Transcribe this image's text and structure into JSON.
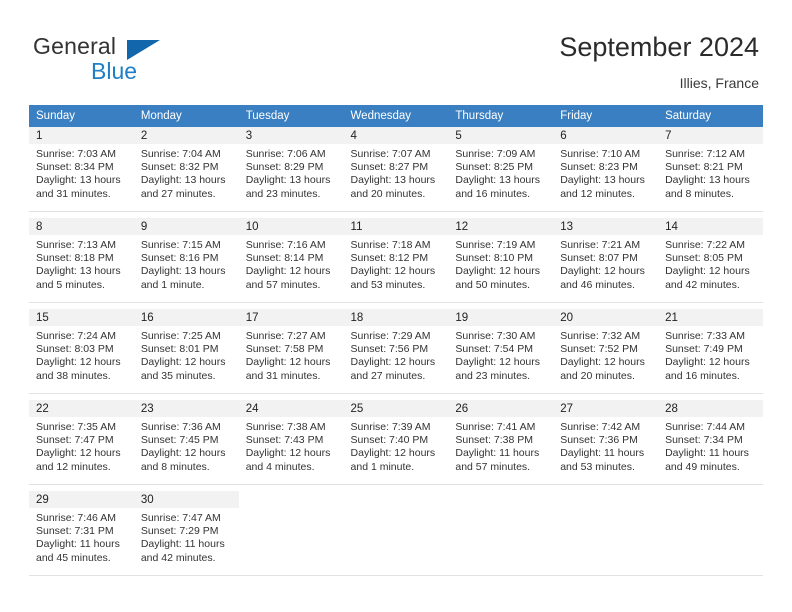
{
  "brand": {
    "word_one": "General",
    "word_two": "Blue",
    "triangle_color": "#1266ac",
    "blue_text_color": "#1f7ec4"
  },
  "header": {
    "title": "September 2024",
    "location": "Illies, France"
  },
  "calendar": {
    "header_bg": "#3a7fc1",
    "header_text_color": "#ffffff",
    "daynum_bg": "#f2f2f2",
    "weekday_headers": [
      "Sunday",
      "Monday",
      "Tuesday",
      "Wednesday",
      "Thursday",
      "Friday",
      "Saturday"
    ],
    "weeks": [
      [
        {
          "day": "1",
          "sunrise": "Sunrise: 7:03 AM",
          "sunset": "Sunset: 8:34 PM",
          "daylight_1": "Daylight: 13 hours",
          "daylight_2": "and 31 minutes."
        },
        {
          "day": "2",
          "sunrise": "Sunrise: 7:04 AM",
          "sunset": "Sunset: 8:32 PM",
          "daylight_1": "Daylight: 13 hours",
          "daylight_2": "and 27 minutes."
        },
        {
          "day": "3",
          "sunrise": "Sunrise: 7:06 AM",
          "sunset": "Sunset: 8:29 PM",
          "daylight_1": "Daylight: 13 hours",
          "daylight_2": "and 23 minutes."
        },
        {
          "day": "4",
          "sunrise": "Sunrise: 7:07 AM",
          "sunset": "Sunset: 8:27 PM",
          "daylight_1": "Daylight: 13 hours",
          "daylight_2": "and 20 minutes."
        },
        {
          "day": "5",
          "sunrise": "Sunrise: 7:09 AM",
          "sunset": "Sunset: 8:25 PM",
          "daylight_1": "Daylight: 13 hours",
          "daylight_2": "and 16 minutes."
        },
        {
          "day": "6",
          "sunrise": "Sunrise: 7:10 AM",
          "sunset": "Sunset: 8:23 PM",
          "daylight_1": "Daylight: 13 hours",
          "daylight_2": "and 12 minutes."
        },
        {
          "day": "7",
          "sunrise": "Sunrise: 7:12 AM",
          "sunset": "Sunset: 8:21 PM",
          "daylight_1": "Daylight: 13 hours",
          "daylight_2": "and 8 minutes."
        }
      ],
      [
        {
          "day": "8",
          "sunrise": "Sunrise: 7:13 AM",
          "sunset": "Sunset: 8:18 PM",
          "daylight_1": "Daylight: 13 hours",
          "daylight_2": "and 5 minutes."
        },
        {
          "day": "9",
          "sunrise": "Sunrise: 7:15 AM",
          "sunset": "Sunset: 8:16 PM",
          "daylight_1": "Daylight: 13 hours",
          "daylight_2": "and 1 minute."
        },
        {
          "day": "10",
          "sunrise": "Sunrise: 7:16 AM",
          "sunset": "Sunset: 8:14 PM",
          "daylight_1": "Daylight: 12 hours",
          "daylight_2": "and 57 minutes."
        },
        {
          "day": "11",
          "sunrise": "Sunrise: 7:18 AM",
          "sunset": "Sunset: 8:12 PM",
          "daylight_1": "Daylight: 12 hours",
          "daylight_2": "and 53 minutes."
        },
        {
          "day": "12",
          "sunrise": "Sunrise: 7:19 AM",
          "sunset": "Sunset: 8:10 PM",
          "daylight_1": "Daylight: 12 hours",
          "daylight_2": "and 50 minutes."
        },
        {
          "day": "13",
          "sunrise": "Sunrise: 7:21 AM",
          "sunset": "Sunset: 8:07 PM",
          "daylight_1": "Daylight: 12 hours",
          "daylight_2": "and 46 minutes."
        },
        {
          "day": "14",
          "sunrise": "Sunrise: 7:22 AM",
          "sunset": "Sunset: 8:05 PM",
          "daylight_1": "Daylight: 12 hours",
          "daylight_2": "and 42 minutes."
        }
      ],
      [
        {
          "day": "15",
          "sunrise": "Sunrise: 7:24 AM",
          "sunset": "Sunset: 8:03 PM",
          "daylight_1": "Daylight: 12 hours",
          "daylight_2": "and 38 minutes."
        },
        {
          "day": "16",
          "sunrise": "Sunrise: 7:25 AM",
          "sunset": "Sunset: 8:01 PM",
          "daylight_1": "Daylight: 12 hours",
          "daylight_2": "and 35 minutes."
        },
        {
          "day": "17",
          "sunrise": "Sunrise: 7:27 AM",
          "sunset": "Sunset: 7:58 PM",
          "daylight_1": "Daylight: 12 hours",
          "daylight_2": "and 31 minutes."
        },
        {
          "day": "18",
          "sunrise": "Sunrise: 7:29 AM",
          "sunset": "Sunset: 7:56 PM",
          "daylight_1": "Daylight: 12 hours",
          "daylight_2": "and 27 minutes."
        },
        {
          "day": "19",
          "sunrise": "Sunrise: 7:30 AM",
          "sunset": "Sunset: 7:54 PM",
          "daylight_1": "Daylight: 12 hours",
          "daylight_2": "and 23 minutes."
        },
        {
          "day": "20",
          "sunrise": "Sunrise: 7:32 AM",
          "sunset": "Sunset: 7:52 PM",
          "daylight_1": "Daylight: 12 hours",
          "daylight_2": "and 20 minutes."
        },
        {
          "day": "21",
          "sunrise": "Sunrise: 7:33 AM",
          "sunset": "Sunset: 7:49 PM",
          "daylight_1": "Daylight: 12 hours",
          "daylight_2": "and 16 minutes."
        }
      ],
      [
        {
          "day": "22",
          "sunrise": "Sunrise: 7:35 AM",
          "sunset": "Sunset: 7:47 PM",
          "daylight_1": "Daylight: 12 hours",
          "daylight_2": "and 12 minutes."
        },
        {
          "day": "23",
          "sunrise": "Sunrise: 7:36 AM",
          "sunset": "Sunset: 7:45 PM",
          "daylight_1": "Daylight: 12 hours",
          "daylight_2": "and 8 minutes."
        },
        {
          "day": "24",
          "sunrise": "Sunrise: 7:38 AM",
          "sunset": "Sunset: 7:43 PM",
          "daylight_1": "Daylight: 12 hours",
          "daylight_2": "and 4 minutes."
        },
        {
          "day": "25",
          "sunrise": "Sunrise: 7:39 AM",
          "sunset": "Sunset: 7:40 PM",
          "daylight_1": "Daylight: 12 hours",
          "daylight_2": "and 1 minute."
        },
        {
          "day": "26",
          "sunrise": "Sunrise: 7:41 AM",
          "sunset": "Sunset: 7:38 PM",
          "daylight_1": "Daylight: 11 hours",
          "daylight_2": "and 57 minutes."
        },
        {
          "day": "27",
          "sunrise": "Sunrise: 7:42 AM",
          "sunset": "Sunset: 7:36 PM",
          "daylight_1": "Daylight: 11 hours",
          "daylight_2": "and 53 minutes."
        },
        {
          "day": "28",
          "sunrise": "Sunrise: 7:44 AM",
          "sunset": "Sunset: 7:34 PM",
          "daylight_1": "Daylight: 11 hours",
          "daylight_2": "and 49 minutes."
        }
      ],
      [
        {
          "day": "29",
          "sunrise": "Sunrise: 7:46 AM",
          "sunset": "Sunset: 7:31 PM",
          "daylight_1": "Daylight: 11 hours",
          "daylight_2": "and 45 minutes."
        },
        {
          "day": "30",
          "sunrise": "Sunrise: 7:47 AM",
          "sunset": "Sunset: 7:29 PM",
          "daylight_1": "Daylight: 11 hours",
          "daylight_2": "and 42 minutes."
        },
        {
          "day": "",
          "sunrise": "",
          "sunset": "",
          "daylight_1": "",
          "daylight_2": ""
        },
        {
          "day": "",
          "sunrise": "",
          "sunset": "",
          "daylight_1": "",
          "daylight_2": ""
        },
        {
          "day": "",
          "sunrise": "",
          "sunset": "",
          "daylight_1": "",
          "daylight_2": ""
        },
        {
          "day": "",
          "sunrise": "",
          "sunset": "",
          "daylight_1": "",
          "daylight_2": ""
        },
        {
          "day": "",
          "sunrise": "",
          "sunset": "",
          "daylight_1": "",
          "daylight_2": ""
        }
      ]
    ]
  }
}
